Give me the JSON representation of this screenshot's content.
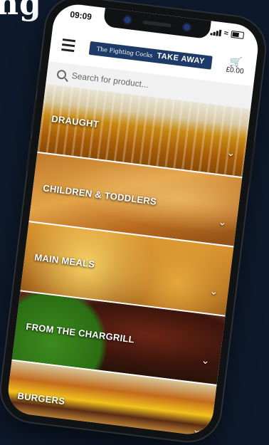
{
  "headline": "ng",
  "status": {
    "time": "09:09"
  },
  "app": {
    "logo_left": "The Fighting Cocks",
    "logo_right": "TAKE AWAY",
    "basket_total": "£0.00"
  },
  "search": {
    "placeholder": "Search for product..."
  },
  "categories": [
    {
      "label": "DRAUGHT"
    },
    {
      "label": "CHILDREN & TODDLERS"
    },
    {
      "label": "MAIN MEALS"
    },
    {
      "label": "FROM THE CHARGRILL"
    },
    {
      "label": "BURGERS"
    }
  ]
}
